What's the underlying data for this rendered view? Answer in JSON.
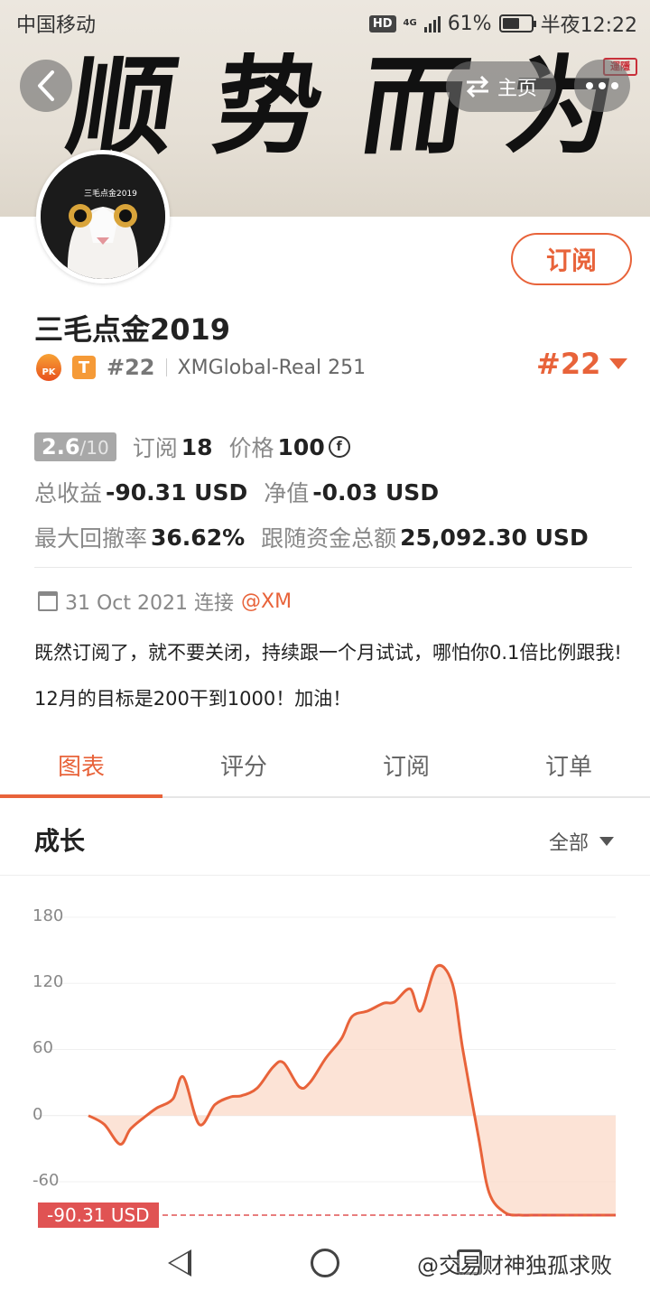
{
  "status_bar": {
    "carrier": "中国移动",
    "hd": "HD",
    "network": "4G",
    "battery_text": "61%",
    "battery_level": 0.61,
    "time": "半夜12:22"
  },
  "banner": {
    "calligraphy": [
      "顺",
      "势",
      "而",
      "为"
    ],
    "seal": "運隱"
  },
  "nav": {
    "home_label": "主页"
  },
  "profile": {
    "avatar_text": "三毛点金2019",
    "subscribe_label": "订阅",
    "name": "三毛点金2019",
    "pk_badge": "PK",
    "t_badge": "T",
    "rank_small": "#22",
    "account": "XMGlobal-Real 251",
    "rank_big": "#22"
  },
  "stats": {
    "score": "2.6",
    "score_max": "/10",
    "subscribe_label": "订阅",
    "subscribe_count": "18",
    "price_label": "价格",
    "price_value": "100",
    "coin_symbol": "f",
    "profit_label": "总收益",
    "profit_value": "-90.31 USD",
    "equity_label": "净值",
    "equity_value": "-0.03 USD",
    "drawdown_label": "最大回撤率",
    "drawdown_value": "36.62%",
    "follow_label": "跟随资金总额",
    "follow_value": "25,092.30 USD"
  },
  "post": {
    "date": "31 Oct 2021 连接",
    "mention": "@XM",
    "text": "既然订阅了，就不要关闭，持续跟一个月试试，哪怕你0.1倍比例跟我! 12月的目标是200干到1000！加油！"
  },
  "tabs": [
    {
      "label": "图表",
      "active": true
    },
    {
      "label": "评分",
      "active": false
    },
    {
      "label": "订阅",
      "active": false
    },
    {
      "label": "订单",
      "active": false
    }
  ],
  "section": {
    "title": "成长",
    "filter": "全部"
  },
  "chart_data": {
    "type": "area",
    "title": "成长",
    "y_ticks": [
      "180",
      "120",
      "60",
      "0",
      "-60"
    ],
    "ylim": [
      -90.31,
      180
    ],
    "final_label": "-90.31 USD",
    "final_value": -90.31,
    "x": [
      0,
      3,
      6,
      8,
      11,
      13,
      16,
      18,
      21,
      24,
      27,
      29,
      32,
      35,
      37,
      40,
      42,
      45,
      48,
      50,
      53,
      56,
      58,
      61,
      63,
      66,
      69,
      71,
      74,
      76,
      79,
      82,
      84,
      87,
      90,
      92,
      94,
      95,
      96,
      97,
      98,
      100
    ],
    "y": [
      0,
      -8,
      -26,
      -12,
      0,
      7,
      15,
      35,
      -8,
      10,
      17,
      18,
      25,
      44,
      48,
      26,
      30,
      52,
      70,
      90,
      95,
      102,
      103,
      115,
      95,
      135,
      120,
      60,
      -20,
      -70,
      -88,
      -90.31,
      -90.31,
      -90.31,
      -90.31,
      -90.31,
      -90.31,
      -90.31,
      -90.31,
      -90.31,
      -90.31,
      -90.31
    ],
    "grid": true,
    "colors": {
      "line": "#e8633a",
      "fill": "#fbd9c8",
      "final": "#e05353"
    }
  },
  "bottom_nav": {
    "watermark": "@交易财神独孤求败"
  }
}
